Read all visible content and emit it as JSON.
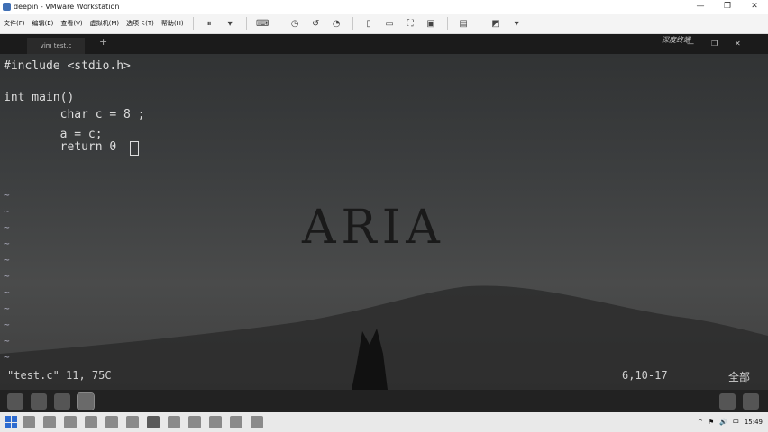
{
  "window": {
    "title": "deepin - VMware Workstation",
    "controls": [
      "—",
      "❐",
      "✕"
    ]
  },
  "menu": [
    "文件(F)",
    "编辑(E)",
    "查看(V)",
    "虚拟机(M)",
    "选项卡(T)",
    "帮助(H)"
  ],
  "toolbar_icons": [
    "pause-icon",
    "send-keys-icon",
    "snapshot-icon",
    "revert-icon",
    "manage-snapshots-icon",
    "sidebar-icon",
    "thumbnail-icon",
    "fullscreen-icon",
    "unity-icon",
    "console-icon"
  ],
  "guest": {
    "tab_label": "vim test.c",
    "new_tab": "+",
    "brand": "深度终端",
    "controls": [
      "—",
      "❐",
      "✕"
    ]
  },
  "editor": {
    "lines": [
      "#include <stdio.h>",
      "",
      "int main()",
      "        char c = 8 ;",
      "        a = c;",
      "        return 0"
    ],
    "status_file": "\"test.c\" 11, 75C",
    "status_pos": "6,10-17",
    "status_all": "全部"
  },
  "wallpaper_text": "ARIA",
  "host_tray": {
    "clock": "15:49",
    "items": [
      "^",
      "⚑",
      "🔊",
      "中"
    ]
  }
}
